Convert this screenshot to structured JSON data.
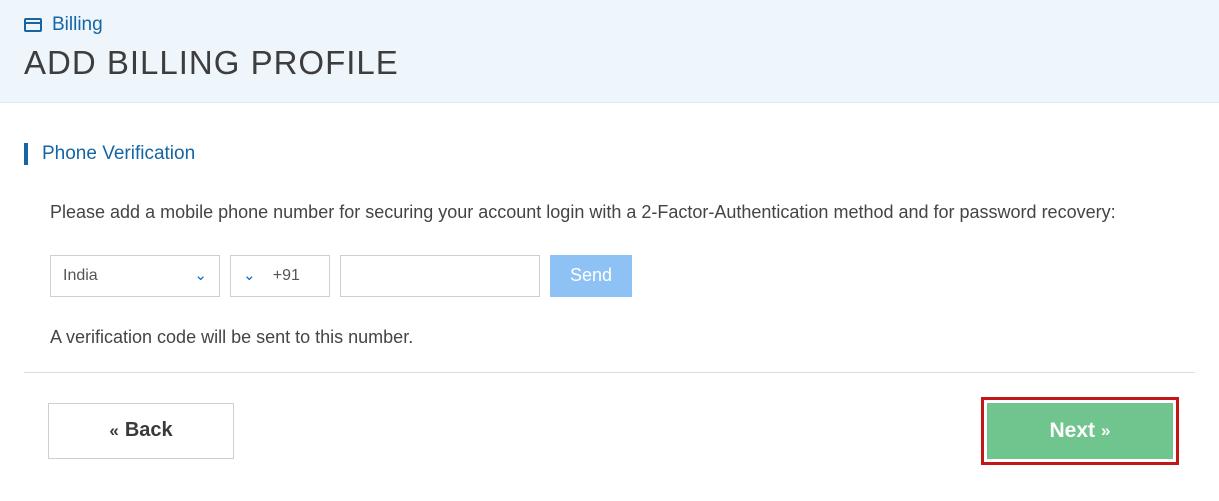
{
  "header": {
    "breadcrumb": "Billing",
    "title": "ADD BILLING PROFILE"
  },
  "section": {
    "title": "Phone Verification",
    "instruction": "Please add a mobile phone number for securing your account login with a 2-Factor-Authentication method and for password recovery:",
    "hint": "A verification code will be sent to this number."
  },
  "phone": {
    "country": "India",
    "dial_code": "+91",
    "number": "",
    "send_label": "Send"
  },
  "footer": {
    "back_label": "Back",
    "next_label": "Next"
  }
}
